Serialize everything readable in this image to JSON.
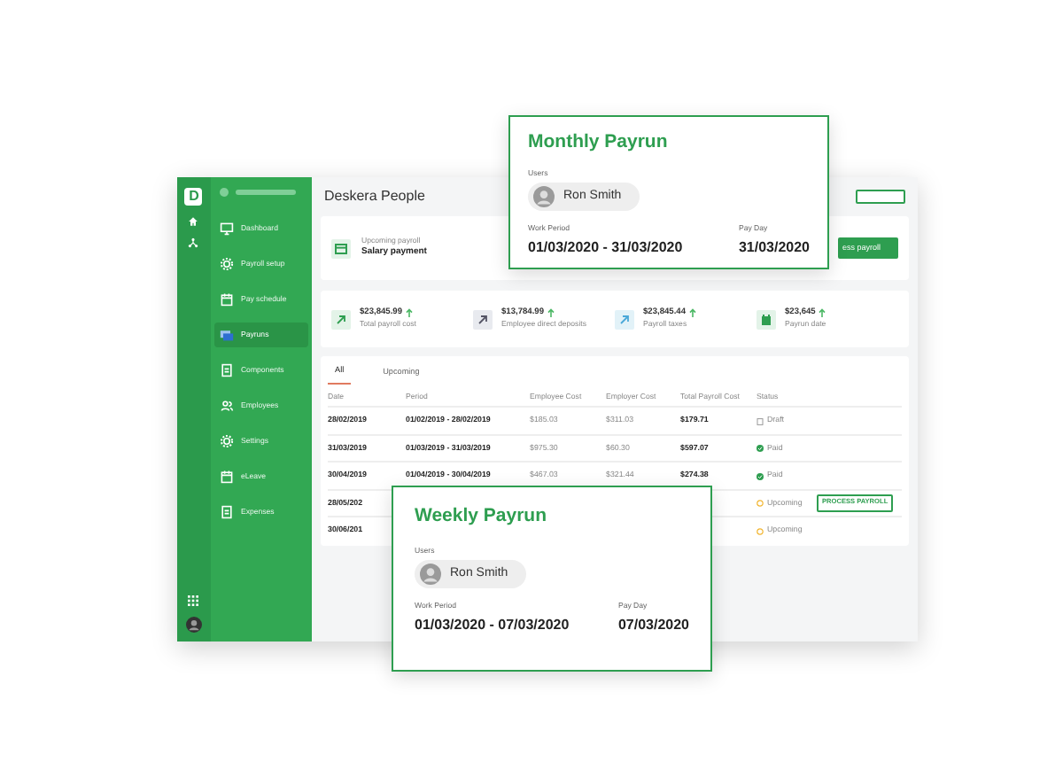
{
  "rail": {
    "logo": "D"
  },
  "sidebar": {
    "items": [
      {
        "label": "Dashboard",
        "kind": "monitor",
        "selected": false
      },
      {
        "label": "Payroll setup",
        "kind": "gear",
        "selected": false
      },
      {
        "label": "Pay schedule",
        "kind": "calendar",
        "selected": false
      },
      {
        "label": "Payruns",
        "kind": "card",
        "selected": true
      },
      {
        "label": "Components",
        "kind": "document",
        "selected": false
      },
      {
        "label": "Employees",
        "kind": "people",
        "selected": false
      },
      {
        "label": "Settings",
        "kind": "gear",
        "selected": false
      },
      {
        "label": "eLeave",
        "kind": "calendar",
        "selected": false
      },
      {
        "label": "Expenses",
        "kind": "document",
        "selected": false
      }
    ]
  },
  "header": {
    "title": "Deskera People"
  },
  "upcoming": {
    "label": "Upcoming payroll",
    "title": "Salary payment",
    "button": "ess payroll"
  },
  "stats": [
    {
      "value": "$23,845.99",
      "label": "Total payroll cost",
      "kind": "arrow-green"
    },
    {
      "value": "$13,784.99",
      "label": "Employee direct deposits",
      "kind": "arrow-grey"
    },
    {
      "value": "$23,845.44",
      "label": "Payroll taxes",
      "kind": "arrow-blue"
    },
    {
      "value": "$23,645",
      "label": "Payrun date",
      "kind": "calendar"
    }
  ],
  "tabs": [
    {
      "label": "All",
      "selected": true
    },
    {
      "label": "Upcoming",
      "selected": false
    }
  ],
  "table": {
    "columns": [
      "Date",
      "Period",
      "Employee Cost",
      "Employer Cost",
      "Total Payroll Cost",
      "Status"
    ],
    "rows": [
      {
        "date": "28/02/2019",
        "period": "01/02/2019 - 28/02/2019",
        "employee_cost": "$185.03",
        "employer_cost": "$311.03",
        "total_cost": "$179.71",
        "status": "Draft",
        "kind": "draft"
      },
      {
        "date": "31/03/2019",
        "period": "01/03/2019 - 31/03/2019",
        "employee_cost": "$975.30",
        "employer_cost": "$60.30",
        "total_cost": "$597.07",
        "status": "Paid",
        "kind": "paid"
      },
      {
        "date": "30/04/2019",
        "period": "01/04/2019 - 30/04/2019",
        "employee_cost": "$467.03",
        "employer_cost": "$321.44",
        "total_cost": "$274.38",
        "status": "Paid",
        "kind": "paid"
      },
      {
        "date": "28/05/202",
        "status": "Upcoming",
        "kind": "upcoming",
        "action": "PROCESS PAYROLL"
      },
      {
        "date": "30/06/201",
        "status": "Upcoming",
        "kind": "upcoming"
      }
    ]
  },
  "popups": [
    {
      "title": "Monthly Payrun",
      "users_label": "Users",
      "user": "Ron Smith",
      "period_label": "Work Period",
      "period": "01/03/2020 - 31/03/2020",
      "payday_label": "Pay Day",
      "payday": "31/03/2020"
    },
    {
      "title": "Weekly Payrun",
      "users_label": "Users",
      "user": "Ron Smith",
      "period_label": "Work Period",
      "period": "01/03/2020 - 07/03/2020",
      "payday_label": "Pay Day",
      "payday": "07/03/2020"
    }
  ]
}
